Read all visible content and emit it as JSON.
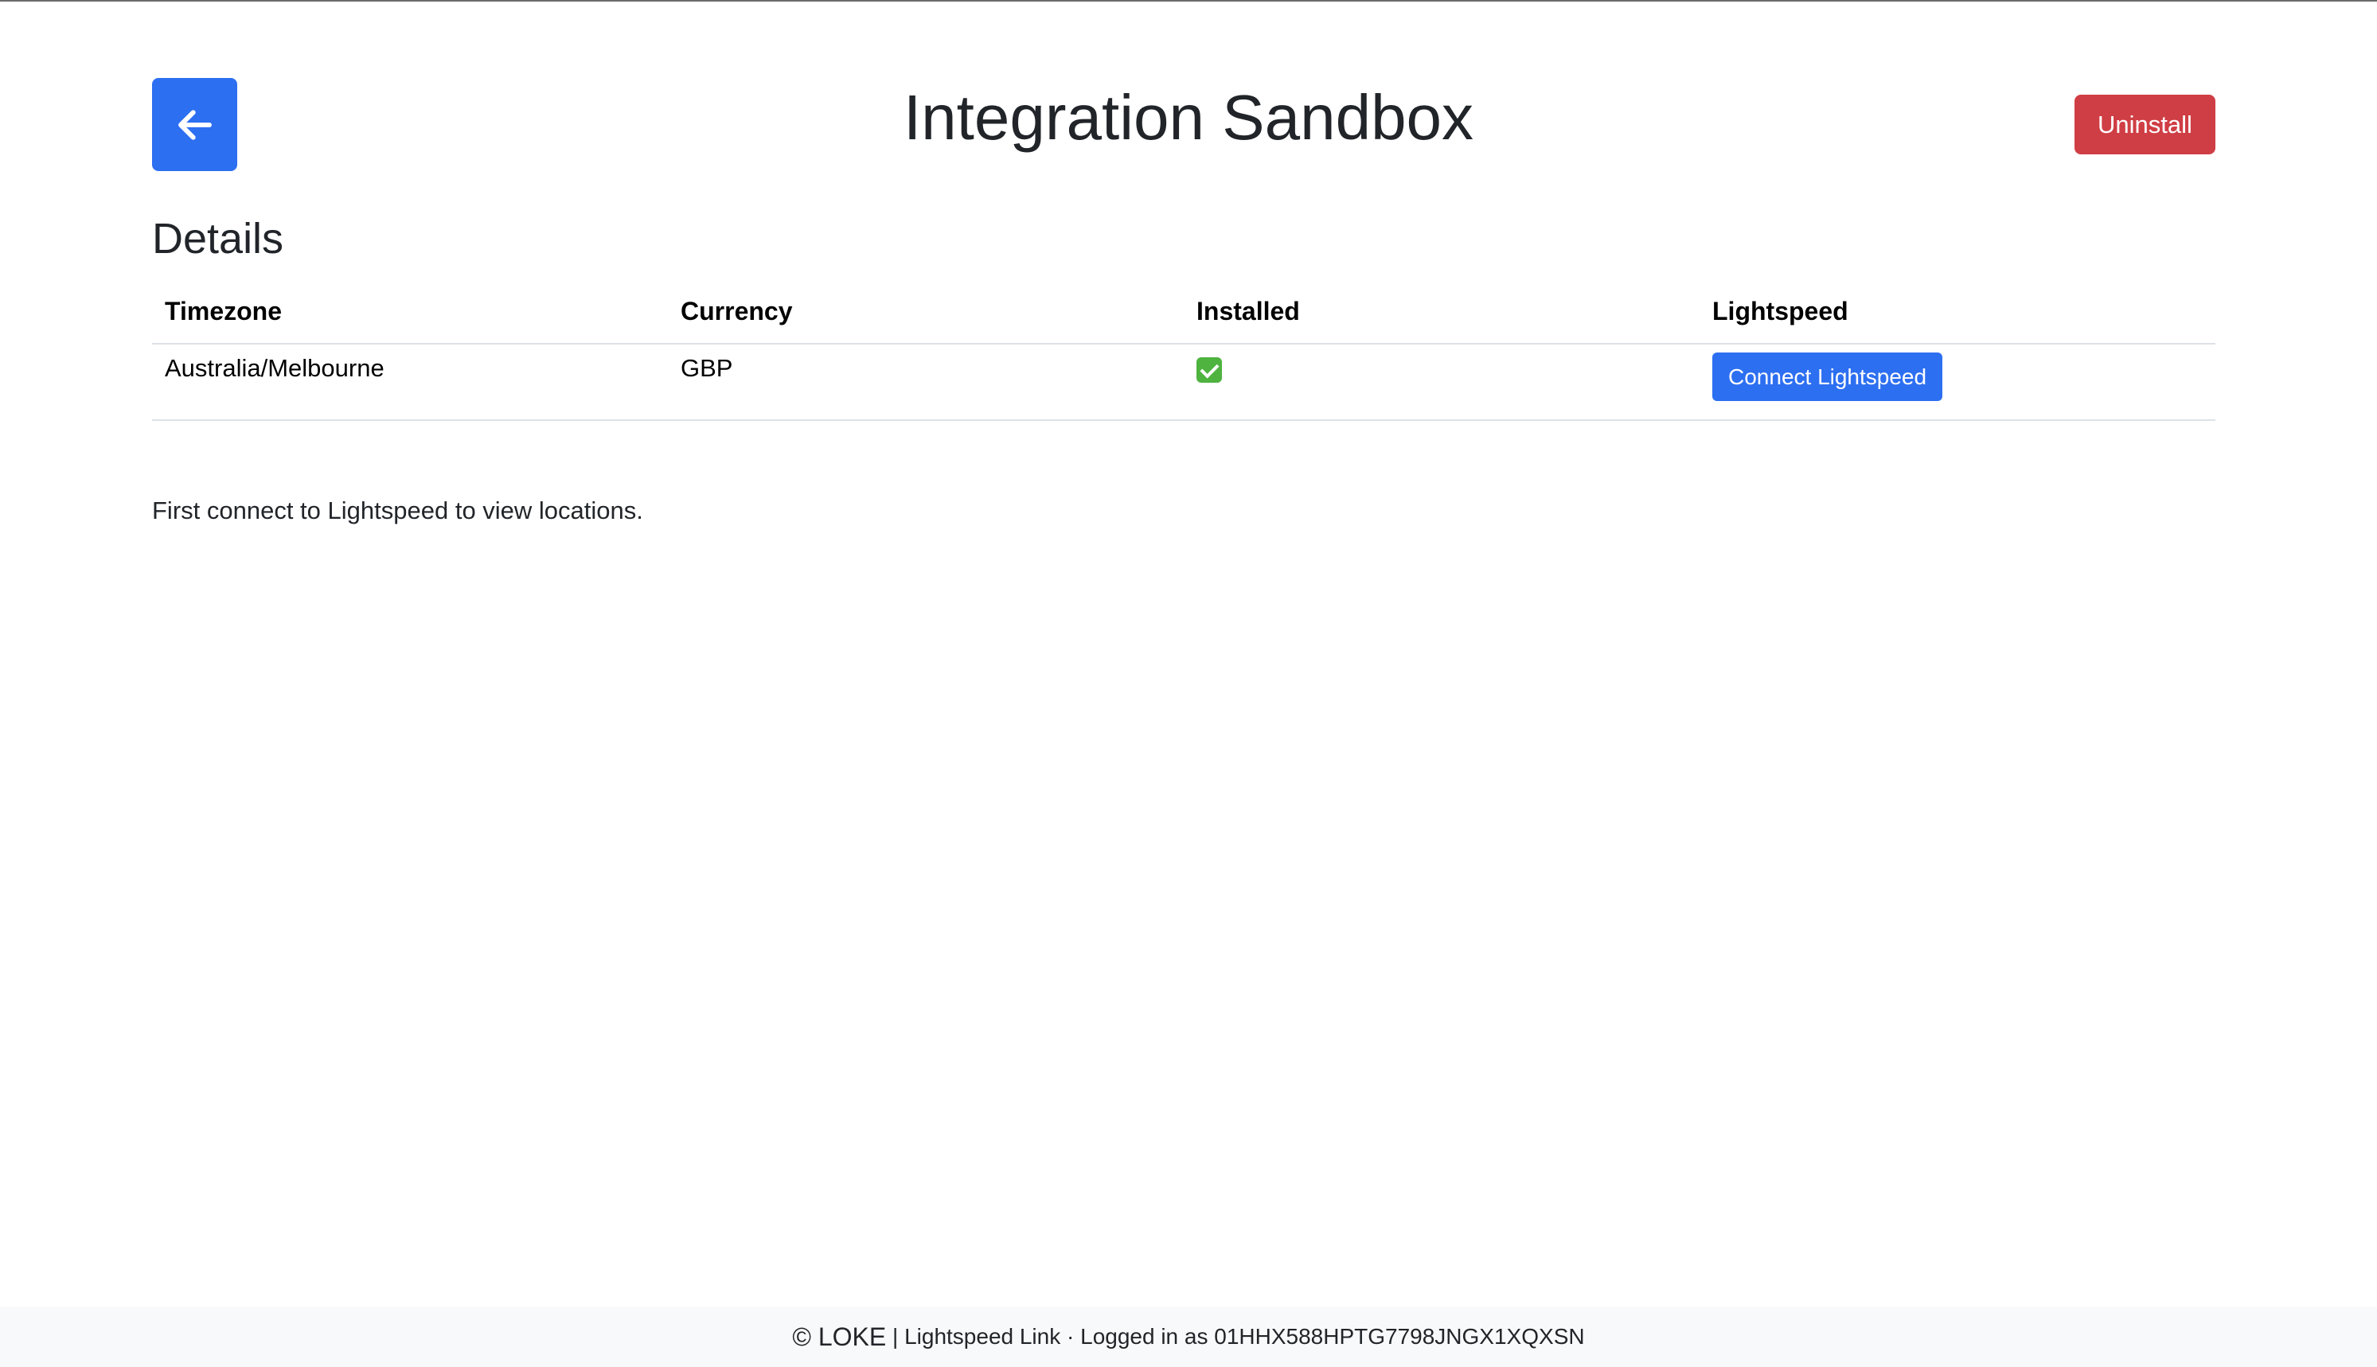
{
  "header": {
    "title": "Integration Sandbox",
    "back_icon": "arrow-left-icon",
    "uninstall_label": "Uninstall"
  },
  "details": {
    "heading": "Details",
    "columns": [
      "Timezone",
      "Currency",
      "Installed",
      "Lightspeed"
    ],
    "row": {
      "timezone": "Australia/Melbourne",
      "currency": "GBP",
      "installed_icon": "check-mark-icon",
      "connect_label": "Connect Lightspeed"
    }
  },
  "message": "First connect to Lightspeed to view locations.",
  "footer": {
    "brand": "© LOKE",
    "separator": " | ",
    "link": "Lightspeed Link",
    "dot": " · ",
    "logged_in": "Logged in as 01HHX588HPTG7798JNGX1XQXSN"
  },
  "colors": {
    "primary": "#2d6ff1",
    "danger": "#cf3e44",
    "success": "#4eb33f",
    "footer_bg": "#f8f9fa"
  }
}
